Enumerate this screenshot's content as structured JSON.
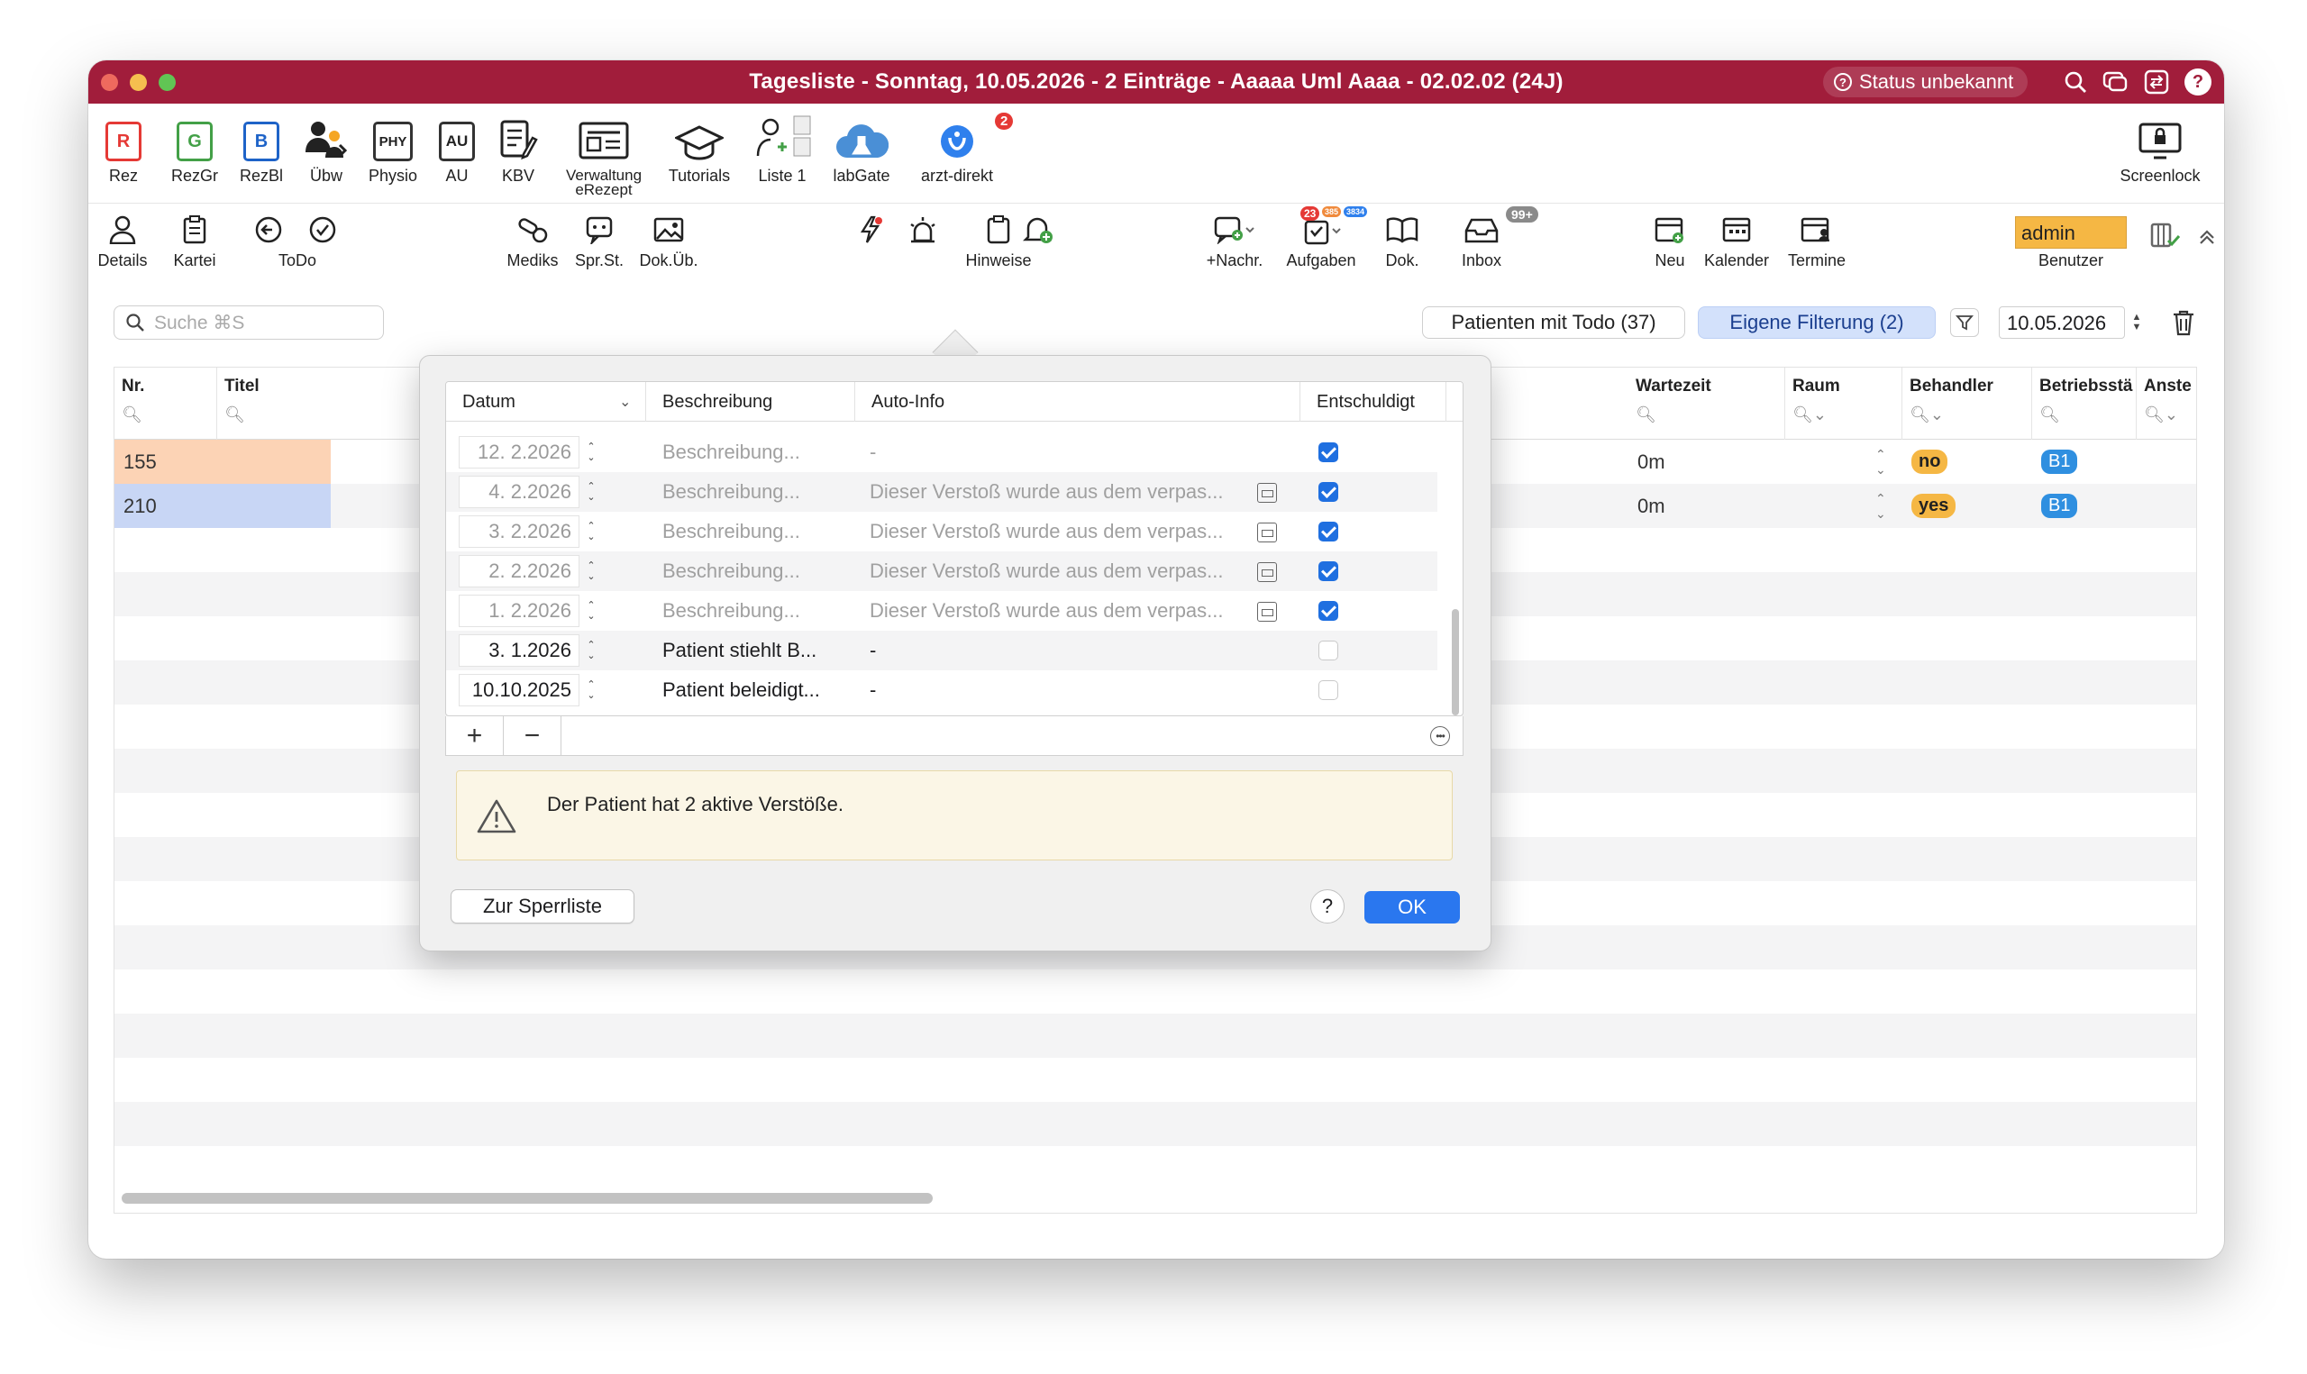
{
  "window": {
    "title": "Tagesliste - Sonntag, 10.05.2026 - 2 Einträge - Aaaaa Uml Aaaa - 02.02.02 (24J)",
    "status": "Status unbekannt"
  },
  "toolbar1": [
    {
      "label": "Rez",
      "icon": "R",
      "color": "#e53935"
    },
    {
      "label": "RezGr",
      "icon": "G",
      "color": "#43a047"
    },
    {
      "label": "RezBl",
      "icon": "B",
      "color": "#1e63c8"
    },
    {
      "label": "Übw"
    },
    {
      "label": "Physio",
      "icon": "PHY"
    },
    {
      "label": "AU",
      "icon": "AU"
    },
    {
      "label": "KBV"
    },
    {
      "label": "Verwaltung eRezept"
    },
    {
      "label": "Tutorials"
    },
    {
      "label": "Liste 1"
    },
    {
      "label": "labGate"
    },
    {
      "label": "arzt-direkt",
      "badge": "2"
    },
    {
      "label": "Screenlock"
    }
  ],
  "toolbar2": {
    "details": "Details",
    "kartei": "Kartei",
    "todo": "ToDo",
    "mediks": "Mediks",
    "sprst": "Spr.St.",
    "dokub": "Dok.Üb.",
    "hinweise": "Hinweise",
    "nachr": "+Nachr.",
    "aufgaben": "Aufgaben",
    "aufgaben_badges": [
      "23",
      "385",
      "3834"
    ],
    "dok": "Dok.",
    "inbox": "Inbox",
    "inbox_badge": "99+",
    "neu": "Neu",
    "kalender": "Kalender",
    "termine": "Termine",
    "user": "admin",
    "benutzer": "Benutzer"
  },
  "filterbar": {
    "search_placeholder": "Suche ⌘S",
    "todo_pill": "Patienten mit Todo (37)",
    "filter_pill": "Eigene Filterung (2)",
    "date": "10.05.2026"
  },
  "table": {
    "columns": {
      "nr": "Nr.",
      "titel": "Titel",
      "wartezeit": "Wartezeit",
      "raum": "Raum",
      "behandler": "Behandler",
      "betriebsstaette": "Betriebsstä",
      "anste": "Anste"
    },
    "rows": [
      {
        "nr": "155",
        "wartezeit": "0m",
        "behandler": "no",
        "betrieb": "B1",
        "color": "#fcd3b5"
      },
      {
        "nr": "210",
        "wartezeit": "0m",
        "behandler": "yes",
        "betrieb": "B1",
        "color": "#c8d6f5"
      }
    ]
  },
  "dialog": {
    "columns": {
      "datum": "Datum",
      "beschreibung": "Beschreibung",
      "autoinfo": "Auto-Info",
      "entschuldigt": "Entschuldigt"
    },
    "rows": [
      {
        "datum": "12.  2.2026",
        "beschreibung": "Beschreibung...",
        "autoinfo": "-",
        "entschuldigt": true,
        "dim": true,
        "autobtn": false
      },
      {
        "datum": "4.  2.2026",
        "beschreibung": "Beschreibung...",
        "autoinfo": "Dieser Verstoß wurde aus dem verpas...",
        "entschuldigt": true,
        "dim": true,
        "autobtn": true
      },
      {
        "datum": "3.  2.2026",
        "beschreibung": "Beschreibung...",
        "autoinfo": "Dieser Verstoß wurde aus dem verpas...",
        "entschuldigt": true,
        "dim": true,
        "autobtn": true
      },
      {
        "datum": "2.  2.2026",
        "beschreibung": "Beschreibung...",
        "autoinfo": "Dieser Verstoß wurde aus dem verpas...",
        "entschuldigt": true,
        "dim": true,
        "autobtn": true
      },
      {
        "datum": "1.  2.2026",
        "beschreibung": "Beschreibung...",
        "autoinfo": "Dieser Verstoß wurde aus dem verpas...",
        "entschuldigt": true,
        "dim": true,
        "autobtn": true
      },
      {
        "datum": "3.  1.2026",
        "beschreibung": "Patient stiehlt B...",
        "autoinfo": "-",
        "entschuldigt": false,
        "dim": false,
        "autobtn": false
      },
      {
        "datum": "10.10.2025",
        "beschreibung": "Patient beleidigt...",
        "autoinfo": "-",
        "entschuldigt": false,
        "dim": false,
        "autobtn": false
      }
    ],
    "add": "+",
    "remove": "−",
    "warning": "Der Patient hat 2 aktive Verstöße.",
    "sperrliste_button": "Zur Sperrliste",
    "help": "?",
    "ok": "OK"
  }
}
